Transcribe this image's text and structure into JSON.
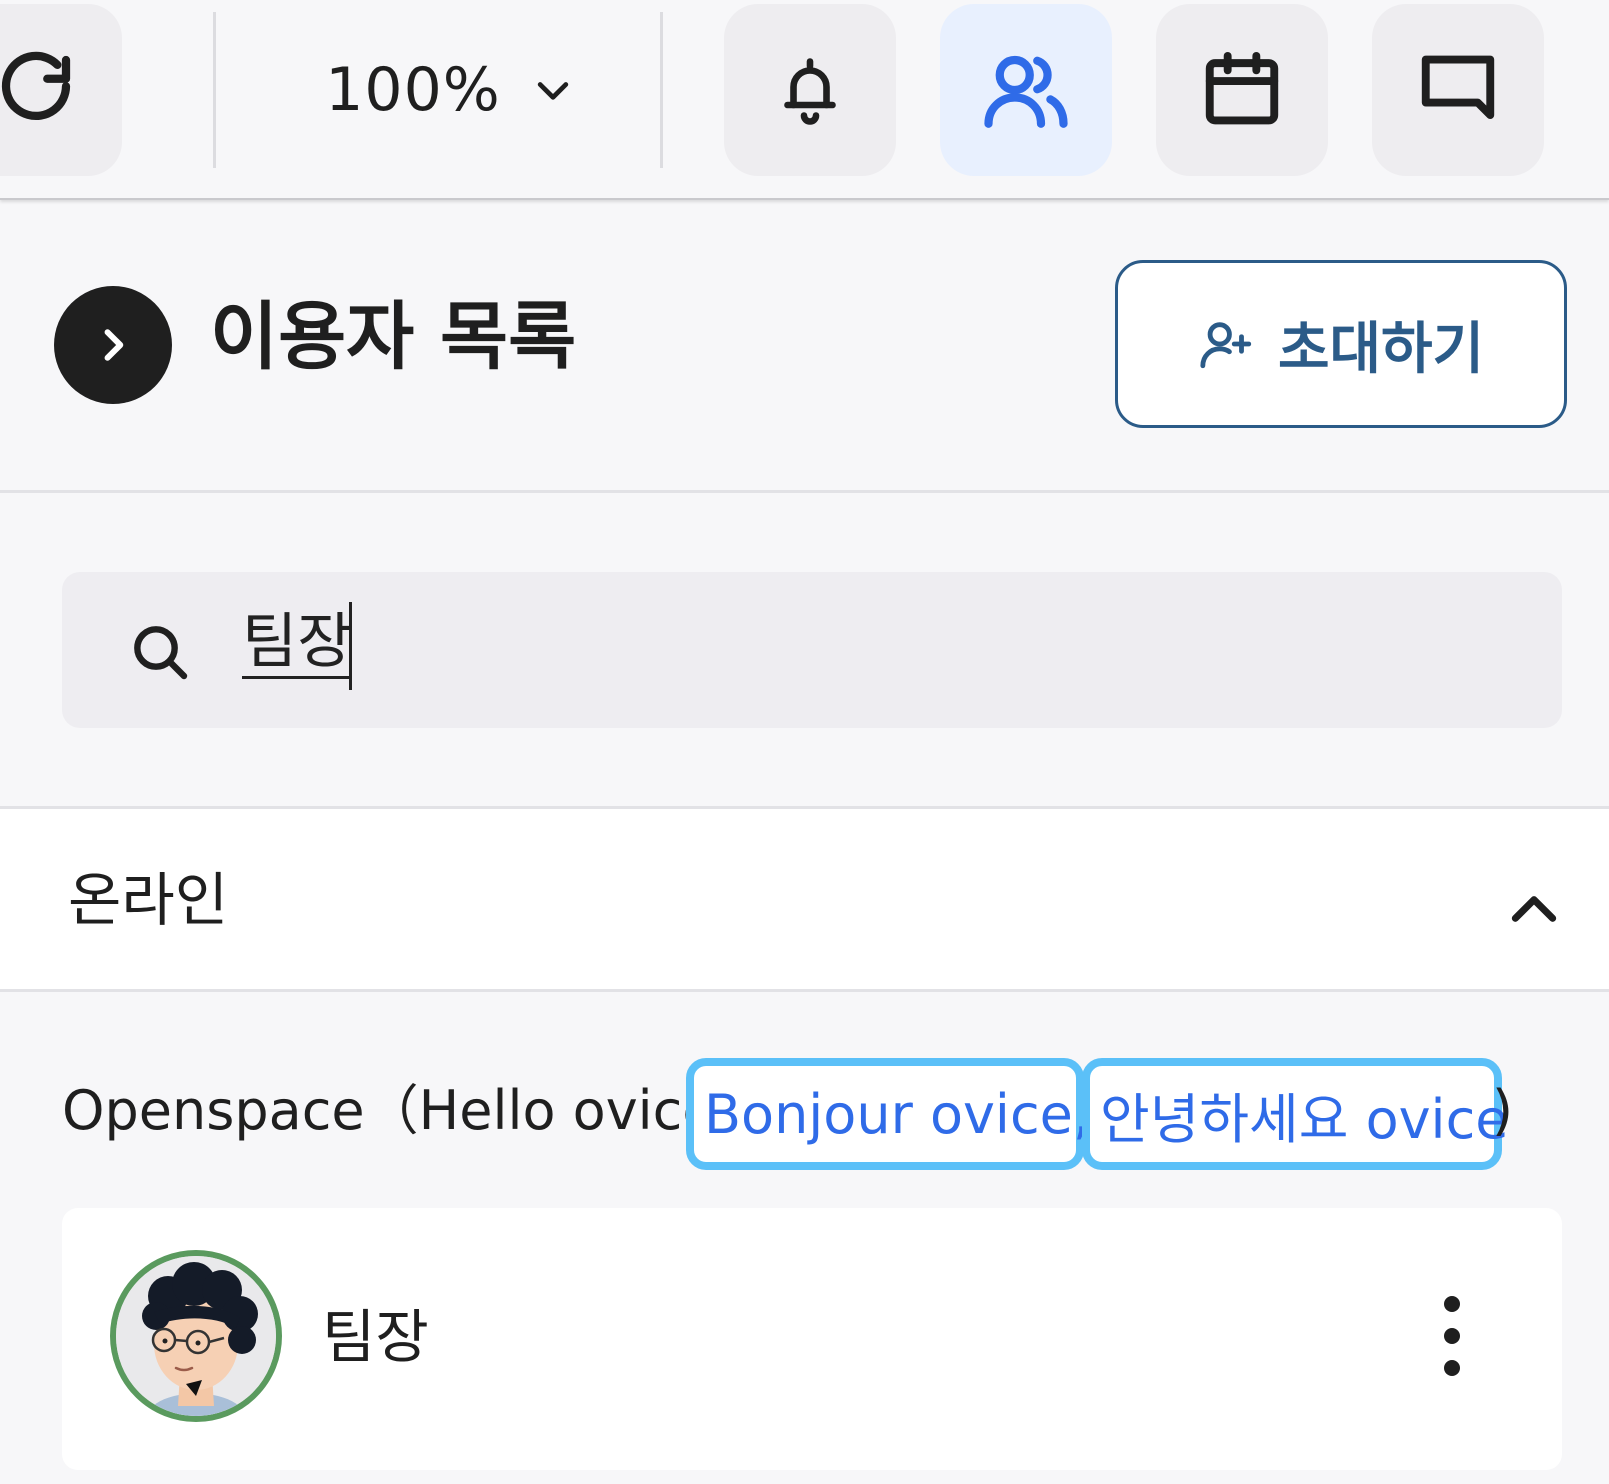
{
  "toolbar": {
    "zoom_value": "100%",
    "icons": [
      "refresh-icon",
      "chevron-down-icon",
      "bell-icon",
      "users-icon",
      "calendar-icon",
      "chat-icon"
    ],
    "active_color": "#2f6be8"
  },
  "header": {
    "title": "이용자 목록",
    "invite_label": "초대하기"
  },
  "search": {
    "value": "팀장"
  },
  "section": {
    "title": "온라인"
  },
  "space": {
    "prefix": "Openspace（Hello ovice",
    "highlight_1": "Bonjour ovice,",
    "highlight_2": "안녕하세요 ovice",
    "suffix": ")",
    "highlight_border_color": "#5bc0f8",
    "highlight_text_color": "#2f6be8"
  },
  "users": [
    {
      "name": "팀장",
      "status_ring_color": "#5a9a5e"
    }
  ]
}
